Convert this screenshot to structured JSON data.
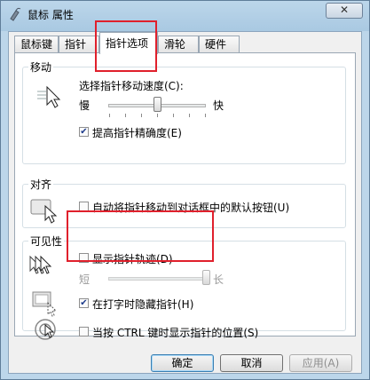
{
  "window": {
    "title": "鼠标 属性",
    "close_glyph": "✕"
  },
  "tabs": [
    {
      "label": "鼠标键"
    },
    {
      "label": "指针"
    },
    {
      "label": "指针选项"
    },
    {
      "label": "滑轮"
    },
    {
      "label": "硬件"
    }
  ],
  "motion": {
    "group_title": "移动",
    "speed_label": "选择指针移动速度(C):",
    "slow_label": "慢",
    "fast_label": "快",
    "speed_value_fraction": 0.5,
    "precision_label": "提高指针精确度(E)",
    "precision_checked": true
  },
  "snap": {
    "group_title": "对齐",
    "snap_label": "自动将指针移动到对话框中的默认按钮(U)",
    "snap_checked": false
  },
  "visibility": {
    "group_title": "可见性",
    "trails_label": "显示指针轨迹(D)",
    "trails_checked": false,
    "short_label": "短",
    "long_label": "长",
    "trail_length_fraction": 1.0,
    "hide_label": "在打字时隐藏指针(H)",
    "hide_checked": true,
    "ctrl_label": "当按 CTRL 键时显示指针的位置(S)",
    "ctrl_checked": false
  },
  "buttons": {
    "ok": "确定",
    "cancel": "取消",
    "apply": "应用(A)"
  },
  "check_glyph": "✔",
  "colors": {
    "highlight_box": "#e0202c"
  }
}
